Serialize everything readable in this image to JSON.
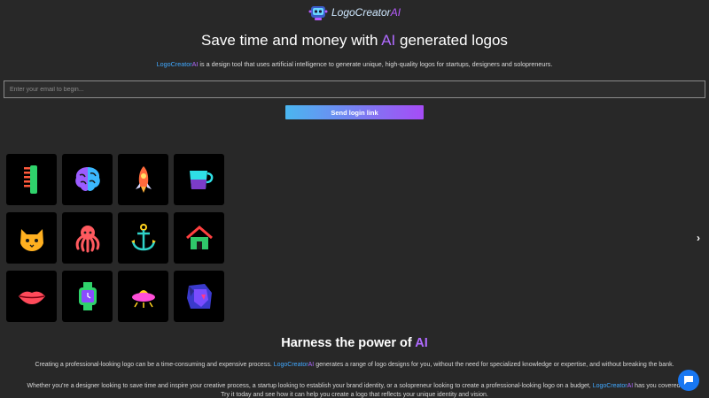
{
  "brand": {
    "name_main": "LogoCreator",
    "name_ai": "AI"
  },
  "hero": {
    "headline_pre": "Save time and money with ",
    "headline_ai": "AI",
    "headline_post": " generated logos",
    "sub_brand_main": "LogoCreator",
    "sub_brand_ai": "AI",
    "sub_text": " is a design tool that uses artificial intelligence to generate unique, high-quality logos for startups, designers and solopreneurs."
  },
  "signup": {
    "email_placeholder": "Enter your email to begin...",
    "send_label": "Send login link"
  },
  "carousel": {
    "prev": "‹",
    "next": "›",
    "tiles": [
      {
        "icon": "comb-icon"
      },
      {
        "icon": "brain-icon"
      },
      {
        "icon": "rocket-icon"
      },
      {
        "icon": "mug-icon"
      },
      {
        "icon": "cat-icon"
      },
      {
        "icon": "octopus-icon"
      },
      {
        "icon": "anchor-icon"
      },
      {
        "icon": "house-icon"
      },
      {
        "icon": "lips-icon"
      },
      {
        "icon": "smartwatch-icon"
      },
      {
        "icon": "ufo-icon"
      },
      {
        "icon": "lion-icon"
      }
    ]
  },
  "features": {
    "title_pre": "Harness the power of ",
    "title_ai": "AI",
    "p1_pre": "Creating a professional-looking logo can be a time-consuming and expensive process. ",
    "p1_brand_main": "LogoCreator",
    "p1_brand_ai": "AI",
    "p1_post": " generates a range of logo designs for you, without the need for specialized knowledge or expertise, and without breaking the bank.",
    "p2_pre": "Whether you're a designer looking to save time and inspire your creative process, a startup looking to establish your brand identity, or a solopreneur looking to create a professional-looking logo on a budget, ",
    "p2_brand_main": "LogoCreator",
    "p2_brand_ai": "AI",
    "p2_post": " has you covered. Try it today and see how it can help you create a logo that reflects your unique identity and vision."
  },
  "colors": {
    "background": "#282828",
    "accent_blue": "#40a8ff",
    "accent_purple": "#b06bff",
    "chat_blue": "#1877f2"
  }
}
